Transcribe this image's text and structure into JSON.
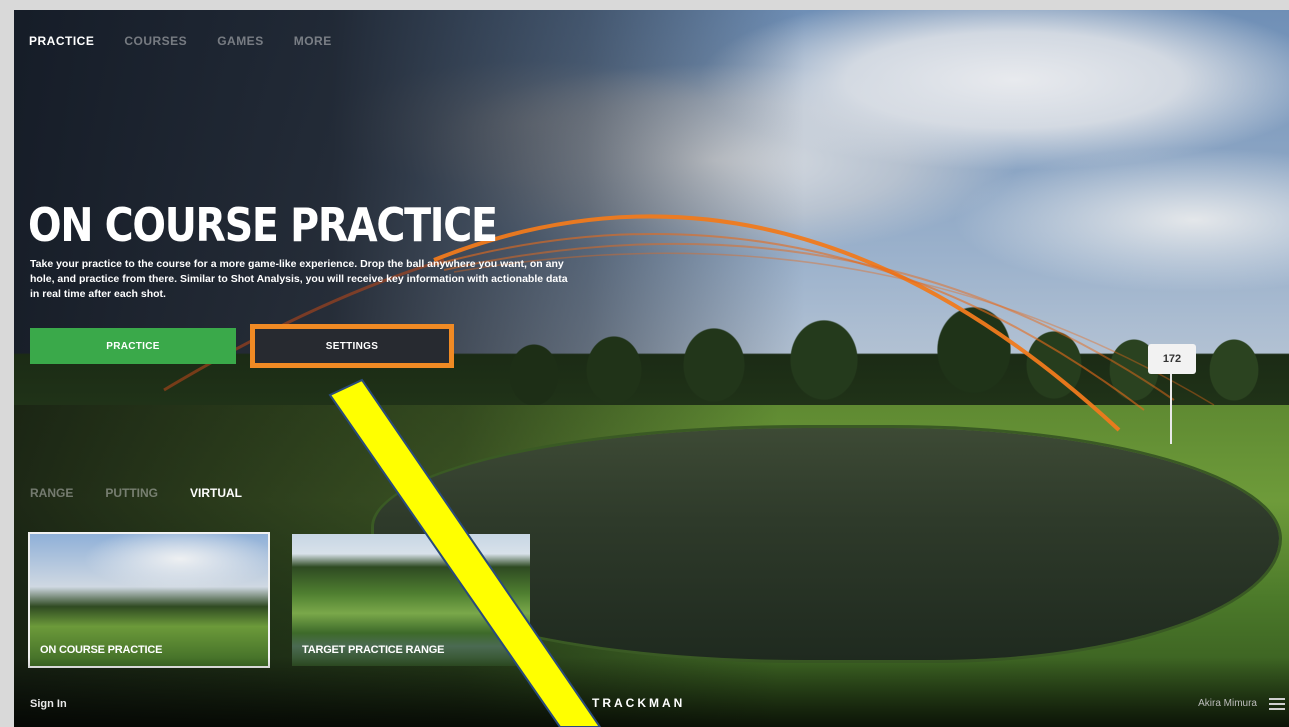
{
  "nav": {
    "tabs": [
      "PRACTICE",
      "COURSES",
      "GAMES",
      "MORE"
    ],
    "active": 0
  },
  "hero": {
    "title": "ON COURSE PRACTICE",
    "description": "Take your practice to the course for a more game-like experience. Drop the ball anywhere you want, on any hole, and practice from there. Similar to Shot Analysis, you will receive key information with actionable data in real time after each shot.",
    "practice_button": "PRACTICE",
    "settings_button": "SETTINGS"
  },
  "flag": {
    "distance": "172"
  },
  "subtabs": {
    "items": [
      "RANGE",
      "PUTTING",
      "VIRTUAL"
    ],
    "active": 2
  },
  "cards": [
    {
      "label": "ON COURSE PRACTICE"
    },
    {
      "label": "TARGET PRACTICE RANGE"
    }
  ],
  "footer": {
    "sign_in": "Sign In",
    "brand": "TRACKMAN",
    "user": "Akira Mimura"
  },
  "colors": {
    "accent_green": "#3aa94a",
    "highlight_orange": "#f08a24",
    "annotation_yellow": "#ffff00"
  }
}
